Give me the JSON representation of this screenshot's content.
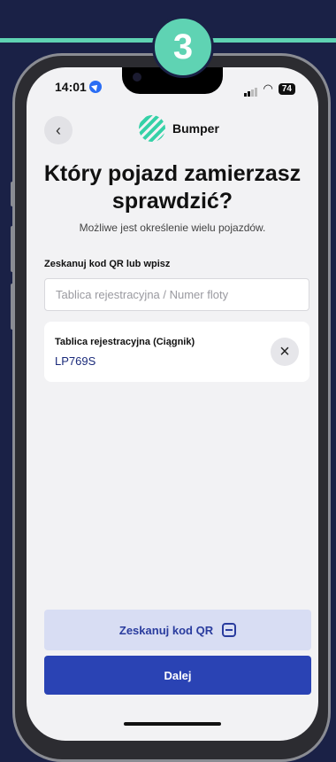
{
  "step_number": "3",
  "colors": {
    "background": "#1a2146",
    "accent": "#5fd3b3",
    "primary_button": "#2a43b4",
    "secondary_button": "#d8ddf3"
  },
  "status_bar": {
    "time": "14:01",
    "battery": "74"
  },
  "header": {
    "brand": "Bumper",
    "back_icon": "chevron-left-icon"
  },
  "title": "Który pojazd zamierzasz sprawdzić?",
  "subtitle": "Możliwe jest określenie wielu pojazdów.",
  "scan_section": {
    "label": "Zeskanuj kod QR lub wpisz",
    "placeholder": "Tablica rejestracyjna / Numer floty",
    "value": ""
  },
  "vehicles": [
    {
      "label": "Tablica rejestracyjna (Ciągnik)",
      "plate": "LP769S"
    }
  ],
  "buttons": {
    "scan_qr": "Zeskanuj kod QR",
    "next": "Dalej"
  }
}
